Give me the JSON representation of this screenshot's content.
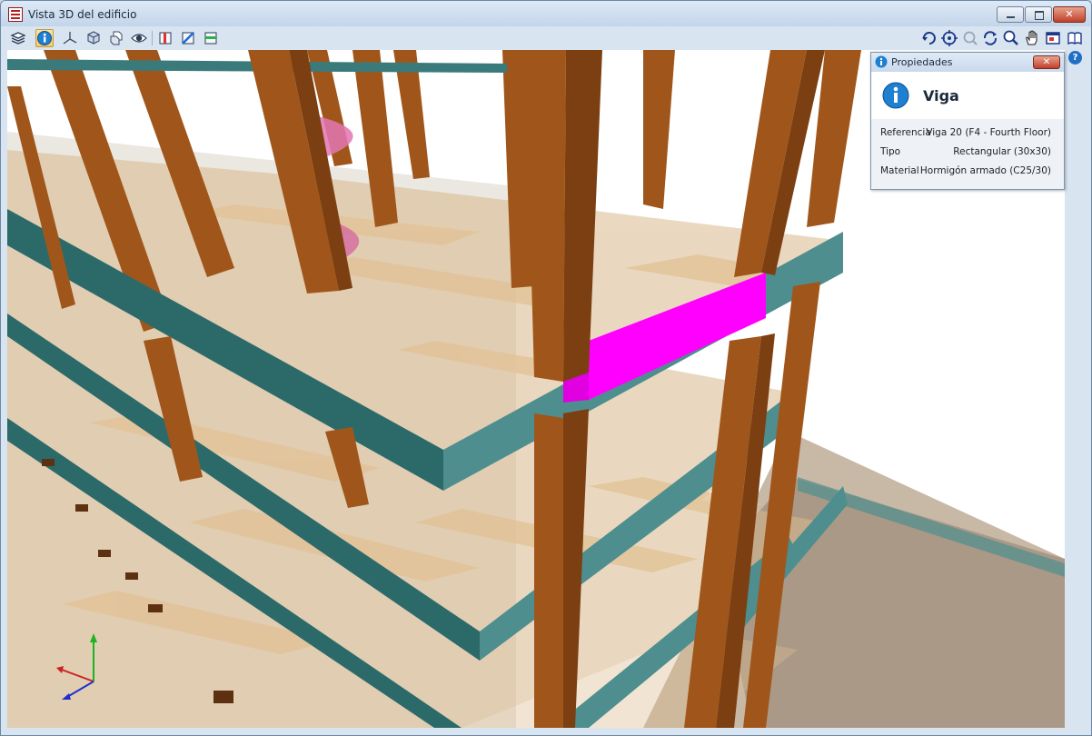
{
  "window": {
    "title": "Vista 3D del edificio"
  },
  "toolbar": {
    "left_icons": [
      "layers-icon",
      "info-icon",
      "axes-icon",
      "cube-icon",
      "cube-group-icon",
      "eye-icon",
      "section-red-icon",
      "section-blue-icon",
      "section-green-icon"
    ],
    "right_icons": [
      "rotate-icon",
      "pan-target-icon",
      "zoom-disabled-icon",
      "refresh-icon",
      "zoom-icon",
      "hand-pan-icon",
      "window-icon",
      "book-icon"
    ]
  },
  "properties_panel": {
    "title": "Propiedades",
    "element_type": "Viga",
    "rows": [
      {
        "label": "Referencia",
        "value": "Viga 20 (F4 - Fourth Floor)"
      },
      {
        "label": "Tipo",
        "value": "Rectangular (30x30)"
      },
      {
        "label": "Material",
        "value": "Hormigón armado (C25/30)"
      }
    ]
  },
  "colors": {
    "column": "#a0561a",
    "beam": "#4f8e8e",
    "slab": "#d8b98c",
    "selected_beam": "#ff00ff",
    "background": "#ffffff"
  }
}
